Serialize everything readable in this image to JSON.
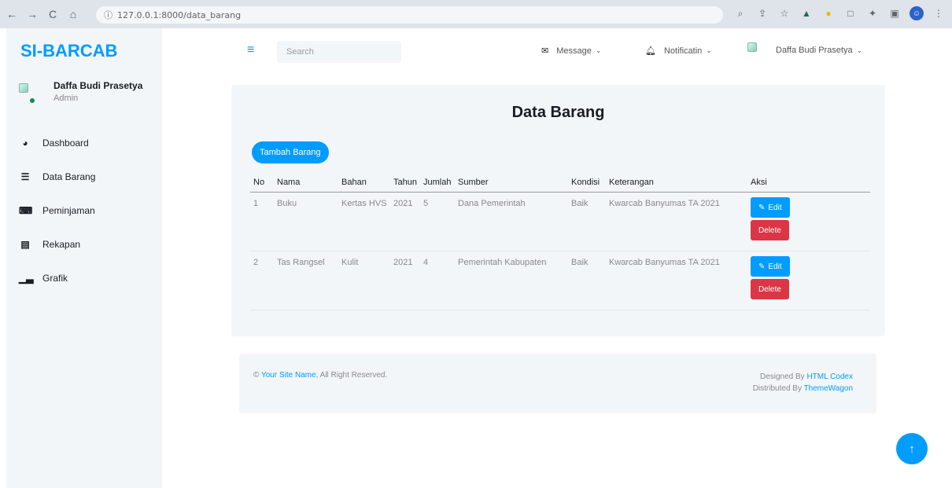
{
  "browser": {
    "url": "127.0.0.1:8000/data_barang",
    "nav": {
      "back": "←",
      "forward": "→",
      "reload": "C",
      "home": "⌂"
    },
    "info_icon": "ⓘ",
    "toolbar_icons": [
      "zoom-icon",
      "share-icon",
      "star-icon",
      "extension-icon",
      "extension-icon",
      "extension-icon",
      "puzzle-icon",
      "sidebar-icon",
      "profile-icon",
      "menu-icon"
    ]
  },
  "sidebar": {
    "brand": "SI-BARCAB",
    "user": {
      "name": "Daffa Budi Prasetya",
      "role": "Admin"
    },
    "items": [
      {
        "label": "Dashboard",
        "icon": "dashboard-icon"
      },
      {
        "label": "Data Barang",
        "icon": "table-icon"
      },
      {
        "label": "Peminjaman",
        "icon": "keyboard-icon"
      },
      {
        "label": "Rekapan",
        "icon": "table-icon"
      },
      {
        "label": "Grafik",
        "icon": "chart-icon"
      }
    ]
  },
  "topbar": {
    "search_placeholder": "Search",
    "message_label": "Message",
    "notification_label": "Notificatin",
    "user_label": "Daffa Budi Prasetya"
  },
  "main": {
    "title": "Data Barang",
    "add_button": "Tambah Barang",
    "columns": [
      "No",
      "Nama",
      "Bahan",
      "Tahun",
      "Jumlah",
      "Sumber",
      "Kondisi",
      "Keterangan",
      "Aksi"
    ],
    "rows": [
      {
        "no": "1",
        "nama": "Buku",
        "bahan": "Kertas HVS",
        "tahun": "2021",
        "jumlah": "5",
        "sumber": "Dana Pemerintah",
        "kondisi": "Baik",
        "keterangan": "Kwarcab Banyumas TA 2021",
        "edit": "Edit",
        "delete": "Delete"
      },
      {
        "no": "2",
        "nama": "Tas Rangsel",
        "bahan": "Kulit",
        "tahun": "2021",
        "jumlah": "4",
        "sumber": "Pemerintah Kabupaten",
        "kondisi": "Baik",
        "keterangan": "Kwarcab Banyumas TA 2021",
        "edit": "Edit",
        "delete": "Delete"
      }
    ]
  },
  "footer": {
    "copyright_prefix": "©",
    "site_name": "Your Site Name",
    "rights": ", All Right Reserved.",
    "designed_prefix": "Designed By",
    "designed_link": "HTML Codex",
    "distributed_prefix": "Distributed By",
    "distributed_link": "ThemeWagon"
  },
  "colors": {
    "primary": "#009cff",
    "danger": "#dc3545",
    "light": "#f3f6f9",
    "dark": "#191c24"
  }
}
